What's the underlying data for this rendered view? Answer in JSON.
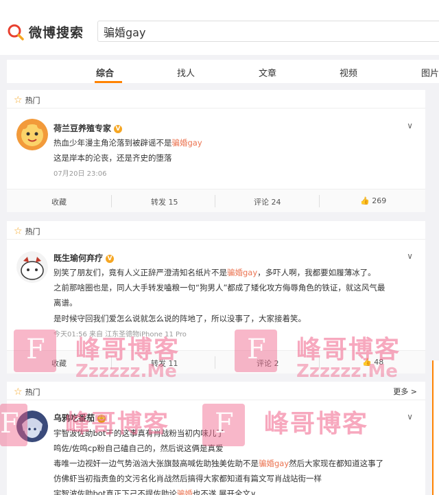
{
  "header": {
    "logo_text": "微博搜索",
    "search_value": "骗婚gay"
  },
  "tabs": [
    "综合",
    "找人",
    "文章",
    "视频",
    "图片"
  ],
  "cards": [
    {
      "label": "热门",
      "username": "荷兰豆养殖专家",
      "lines": [
        {
          "pre": "热血少年漫主角沦落到被辟谣不是",
          "hl": "骗婚gay",
          "post": ""
        },
        {
          "pre": "这是岸本的沦丧，还是齐史的堕落",
          "hl": "",
          "post": ""
        }
      ],
      "meta": "07月20日 23:06",
      "actions": {
        "collect": "收藏",
        "repost": "转发 15",
        "comment": "评论 24",
        "like": "269"
      }
    },
    {
      "label": "热门",
      "username": "既生瑜何弃疗",
      "lines": [
        {
          "pre": "别笑了朋友们，竟有人义正辞严澄清知名纸片不是",
          "hl": "骗婚gay",
          "post": "，多吓人啊，我都要如履薄冰了。"
        },
        {
          "pre": "之前那啥圈也是，同人大手转发嗑粮一句“狗男人”都成了矮化攻方侮辱角色的铁证，就这风气最",
          "hl": "",
          "post": ""
        },
        {
          "pre": "离谱。",
          "hl": "",
          "post": ""
        },
        {
          "pre": "是时候守回我们爱怎么说就怎么说的阵地了，所以没事了，大家接着笑。",
          "hl": "",
          "post": ""
        }
      ],
      "meta": "今天01:56 来自 江东圣德物iPhone 11 Pro",
      "actions": {
        "collect": "收藏",
        "repost": "转发 11",
        "comment": "评论 2",
        "like": "48"
      }
    },
    {
      "label": "热门",
      "more": "更多 >",
      "username": "乌鸦吃番茄",
      "lines": [
        {
          "pre": "宇智波佐助bot干的这事真有肖战粉当初内味儿了",
          "hl": "",
          "post": ""
        },
        {
          "pre": "鸣佐/佐鸣cp粉自己磕自己的，然后说这俩是真爱",
          "hl": "",
          "post": ""
        },
        {
          "pre": "毒唯一边视奸一边气势汹汹大张旗鼓高喊佐助独美佐助不是",
          "hl": "骗婚gay",
          "post": "然后大家现在都知道这事了"
        },
        {
          "pre": "仿佛虾当初指责鱼的文污名化肖战然后搞得大家都知道有篇文写肖战站街一样",
          "hl": "",
          "post": ""
        },
        {
          "pre": "宇智波佐助bot真正下己不提佐助论",
          "hl": "骗婚",
          "post": "也不遂  展开全文∨"
        }
      ]
    }
  ],
  "watermark": {
    "brand": "峰哥博客",
    "url": "Zzzzzz.Me",
    "letter": "F"
  }
}
